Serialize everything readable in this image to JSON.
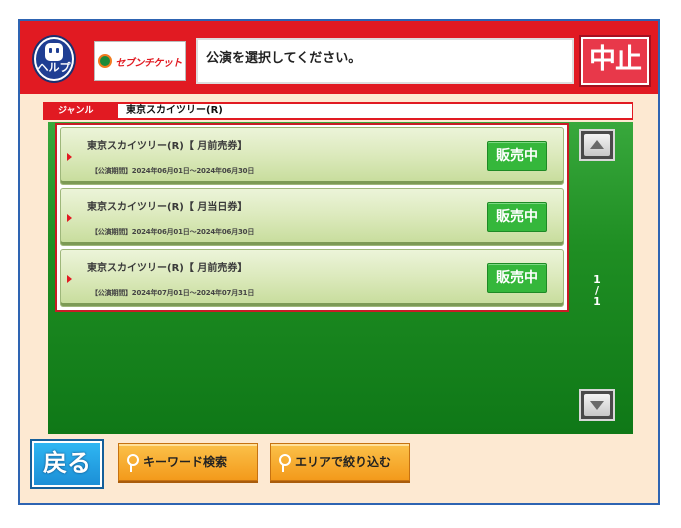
{
  "header": {
    "help_label": "ヘルプ",
    "logo_text": "セブンチケット",
    "message": "公演を選択してください。",
    "stop_label": "中止"
  },
  "genre": {
    "label": "ジャンル",
    "value": "東京スカイツリー(R)"
  },
  "events": [
    {
      "title": "東京スカイツリー(R)【 月前売券】",
      "period": "【公演期間】2024年06月01日～2024年06月30日",
      "status": "販売中"
    },
    {
      "title": "東京スカイツリー(R)【 月当日券】",
      "period": "【公演期間】2024年06月01日～2024年06月30日",
      "status": "販売中"
    },
    {
      "title": "東京スカイツリー(R)【 月前売券】",
      "period": "【公演期間】2024年07月01日～2024年07月31日",
      "status": "販売中"
    }
  ],
  "pagination": {
    "current": "1",
    "separator": "/",
    "total": "1"
  },
  "footer": {
    "back_label": "戻る",
    "keyword_label": "キーワード検索",
    "area_label": "エリアで絞り込む"
  },
  "colors": {
    "header_red": "#e11a22",
    "panel_green": "#1f8e23",
    "frame_blue": "#2e64b2",
    "background": "#fde9d2",
    "status_green": "#35b73b",
    "button_orange": "#f39a1b",
    "back_blue": "#1c8fd6"
  },
  "icons": {
    "help": "help-face-icon",
    "scroll_up": "triangle-up-icon",
    "scroll_down": "triangle-down-icon",
    "row_marker": "triangle-right-icon",
    "search": "key-search-icon"
  }
}
